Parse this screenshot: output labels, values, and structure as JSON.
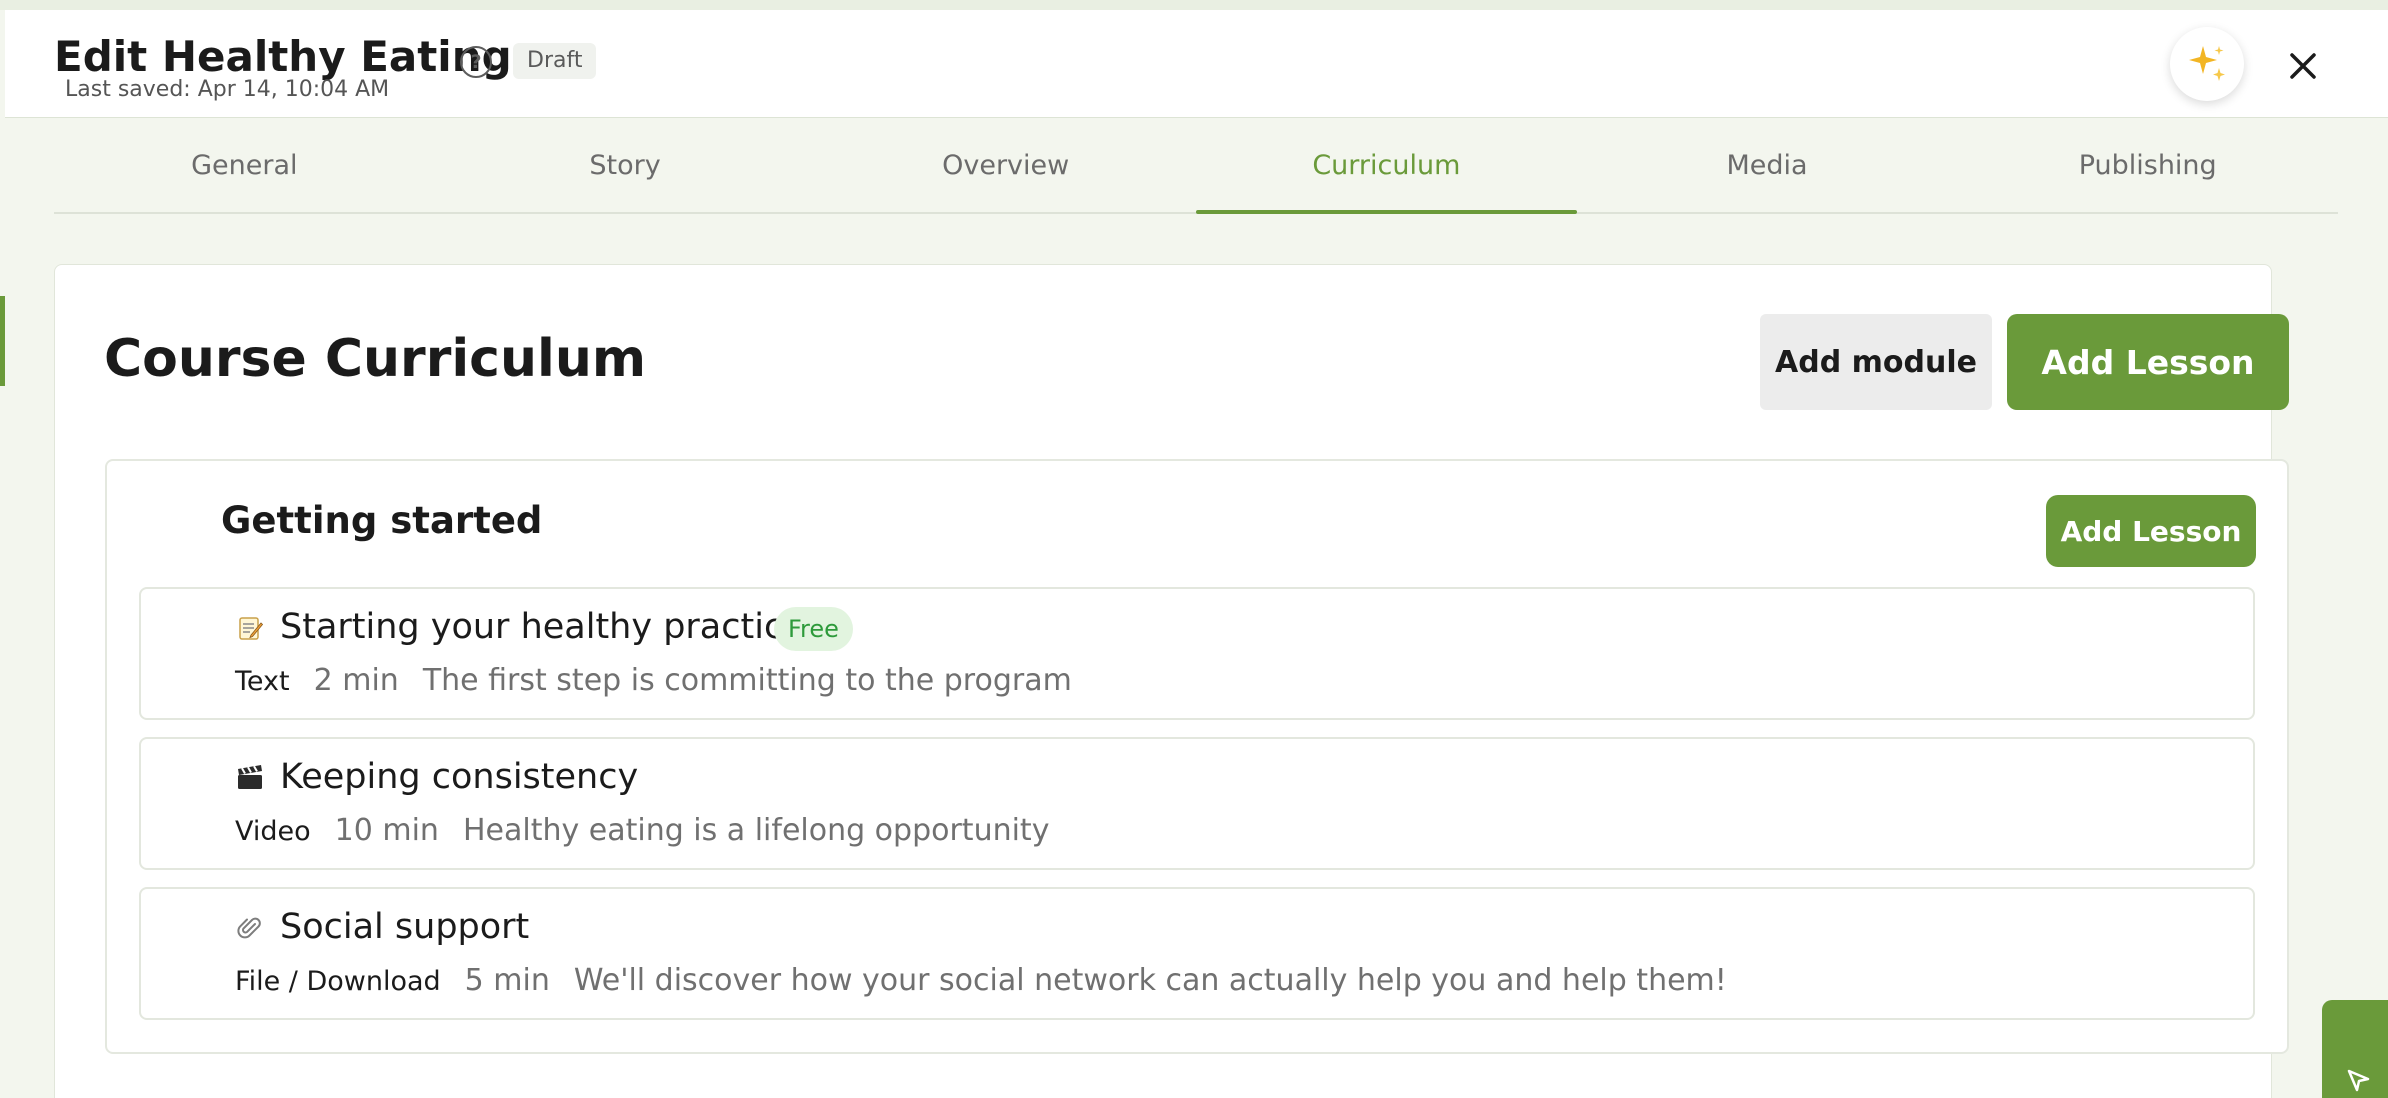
{
  "header": {
    "title": "Edit Healthy Eating",
    "help_icon": "question-circle-icon",
    "status_badge": "Draft",
    "last_saved": "Last saved: Apr 14, 10:04 AM",
    "assistant_icon": "sparkles-icon",
    "close_icon": "close-icon"
  },
  "tabs": [
    {
      "label": "General",
      "active": false
    },
    {
      "label": "Story",
      "active": false
    },
    {
      "label": "Overview",
      "active": false
    },
    {
      "label": "Curriculum",
      "active": true
    },
    {
      "label": "Media",
      "active": false
    },
    {
      "label": "Publishing",
      "active": false
    }
  ],
  "curriculum": {
    "title": "Course Curriculum",
    "add_module_label": "Add module",
    "add_lesson_label": "Add Lesson",
    "modules": [
      {
        "title": "Getting started",
        "add_lesson_label": "Add Lesson",
        "lessons": [
          {
            "icon": "memo-icon",
            "title": "Starting your healthy practice",
            "badge": "Free",
            "type": "Text",
            "duration": "2 min",
            "description": "The first step is committing to the program"
          },
          {
            "icon": "clapper-board-icon",
            "title": "Keeping consistency",
            "badge": "",
            "type": "Video",
            "duration": "10 min",
            "description": "Healthy eating is a lifelong opportunity"
          },
          {
            "icon": "paperclip-icon",
            "title": "Social support",
            "badge": "",
            "type": "File / Download",
            "duration": "5 min",
            "description": "We'll discover how your social network can actually help you and help them!"
          }
        ]
      }
    ]
  },
  "colors": {
    "accent": "#6a9a3a",
    "free_badge_bg": "#e2f4df",
    "free_badge_text": "#2e9a3b",
    "page_bg": "#f3f6ee"
  }
}
